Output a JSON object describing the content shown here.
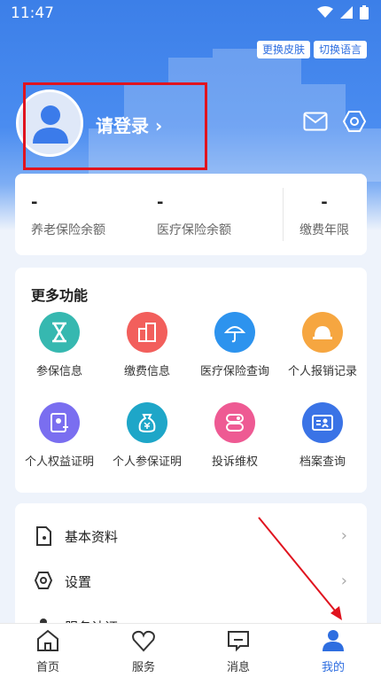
{
  "status": {
    "time": "11:47"
  },
  "header": {
    "skin_button": "更换皮肤",
    "lang_button": "切换语言",
    "login_text": "请登录 ›"
  },
  "stats": [
    {
      "value": "-",
      "label": "养老保险余额"
    },
    {
      "value": "-",
      "label": "医疗保险余额"
    },
    {
      "value": "-",
      "label": "缴费年限"
    }
  ],
  "more": {
    "title": "更多功能",
    "items": [
      {
        "label": "参保信息",
        "color": "#36b8b0"
      },
      {
        "label": "缴费信息",
        "color": "#f25f5c"
      },
      {
        "label": "医疗保险查询",
        "color": "#2d93ee"
      },
      {
        "label": "个人报销记录",
        "color": "#f6a640"
      },
      {
        "label": "个人权益证明",
        "color": "#7a6ef0"
      },
      {
        "label": "个人参保证明",
        "color": "#1ea6c8"
      },
      {
        "label": "投诉维权",
        "color": "#ee5a93"
      },
      {
        "label": "档案查询",
        "color": "#3a73e6"
      }
    ]
  },
  "menu": [
    {
      "label": "基本资料"
    },
    {
      "label": "设置"
    },
    {
      "label": "服务认证"
    }
  ],
  "tabs": [
    {
      "label": "首页"
    },
    {
      "label": "服务"
    },
    {
      "label": "消息"
    },
    {
      "label": "我的"
    }
  ],
  "colors": {
    "accent": "#2e6ee0",
    "highlight_box": "#e0141f"
  }
}
